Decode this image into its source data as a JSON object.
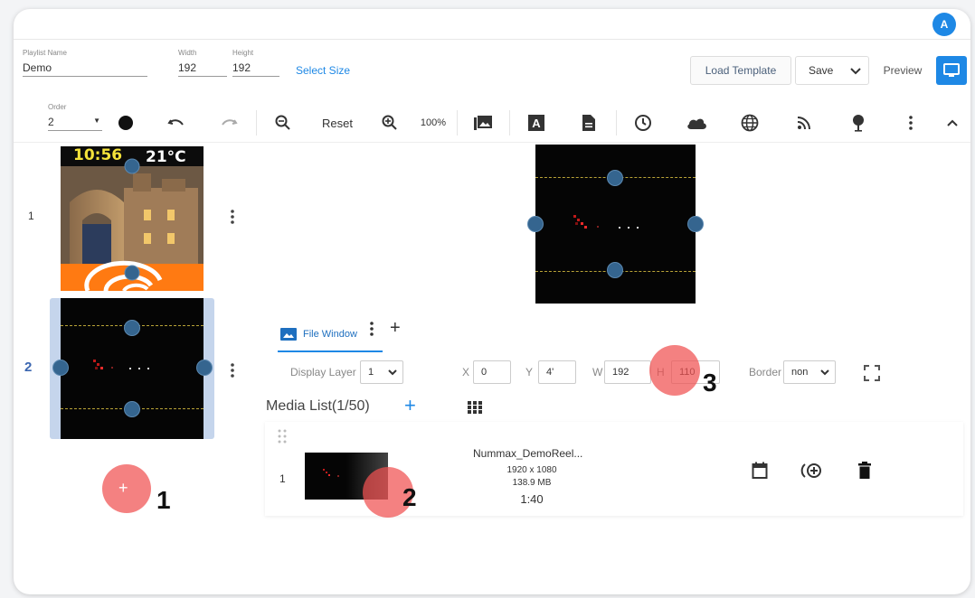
{
  "header": {
    "avatar_initial": "A",
    "playlist_name_label": "Playlist Name",
    "playlist_name_value": "Demo",
    "width_label": "Width",
    "width_value": "192",
    "height_label": "Height",
    "height_value": "192",
    "select_size_label": "Select Size",
    "load_template_label": "Load Template",
    "save_label": "Save",
    "preview_label": "Preview"
  },
  "toolbar": {
    "order_label": "Order",
    "order_value": "2",
    "reset_label": "Reset",
    "zoom_level": "100%",
    "icons": [
      "circle-icon",
      "undo-icon",
      "redo-icon",
      "zoom-out-icon",
      "zoom-in-icon",
      "image-icon",
      "text-icon",
      "document-icon",
      "clock-icon",
      "cloud-icon",
      "globe-icon",
      "rss-icon",
      "tree-icon",
      "more-icon",
      "collapse-icon"
    ]
  },
  "pages": [
    {
      "number": "1",
      "clock_text": "10:56",
      "temp_text": "21°C"
    },
    {
      "number": "2"
    }
  ],
  "window_tab": {
    "label": "File Window"
  },
  "properties": {
    "display_layer_label": "Display Layer",
    "display_layer_value": "1",
    "x_label": "X",
    "x_value": "0",
    "y_label": "Y",
    "y_value": "4'",
    "w_label": "W",
    "w_value": "192",
    "h_label": "H",
    "h_value": "110",
    "border_label": "Border",
    "border_value": "non"
  },
  "media_list": {
    "title": "Media List(1/50)",
    "items": [
      {
        "index": "1",
        "name": "Nummax_DemoReel...",
        "resolution": "1920 x 1080",
        "size": "138.9 MB",
        "duration": "1:40"
      }
    ]
  },
  "callouts": [
    "1",
    "2",
    "3"
  ],
  "colors": {
    "accent": "#1e88e5",
    "handle": "#35658f",
    "callout_marker": "#f05050",
    "selected_page_bg": "#c5d5ec"
  }
}
